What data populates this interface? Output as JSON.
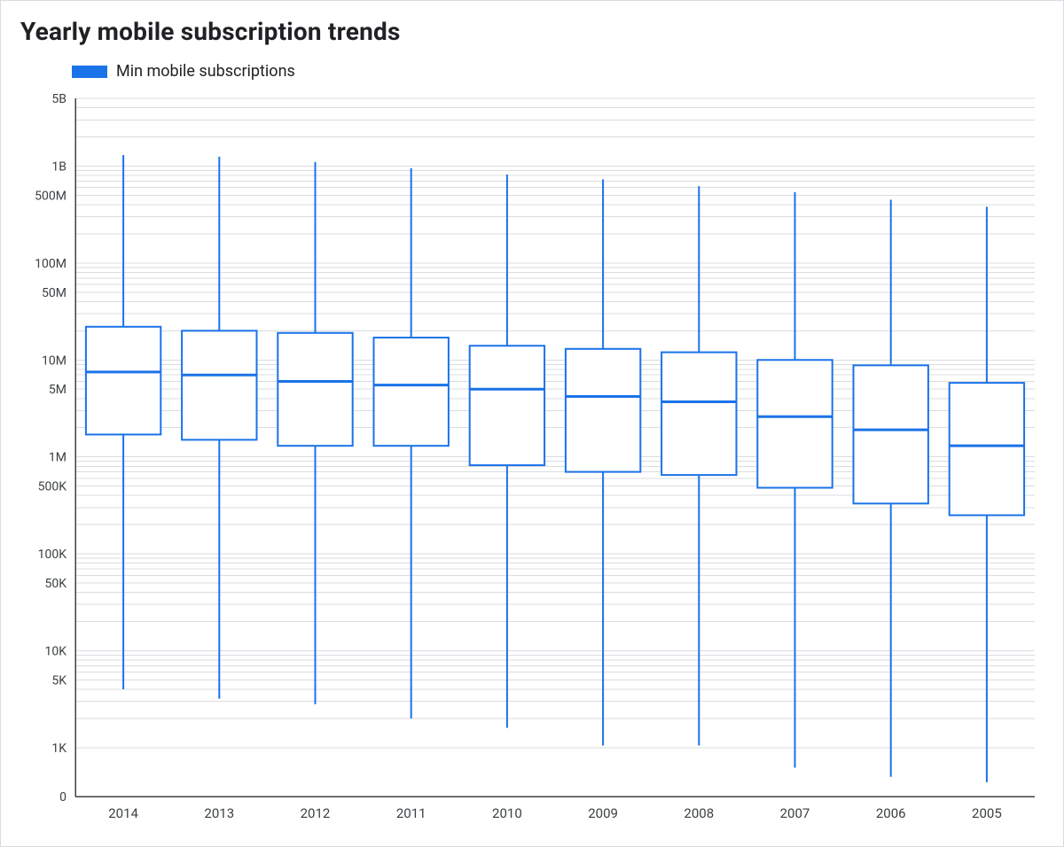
{
  "title": "Yearly mobile subscription trends",
  "legend": {
    "label": "Min mobile subscriptions",
    "color": "#1a73e8"
  },
  "chart_data": {
    "type": "box",
    "xlabel": "",
    "ylabel": "",
    "x_categories": [
      "2014",
      "2013",
      "2012",
      "2011",
      "2010",
      "2009",
      "2008",
      "2007",
      "2006",
      "2005"
    ],
    "y_scale": "log_with_zero",
    "y_ticks": [
      {
        "v": 0,
        "label": "0"
      },
      {
        "v": 1000,
        "label": "1K"
      },
      {
        "v": 5000,
        "label": "5K"
      },
      {
        "v": 10000,
        "label": "10K"
      },
      {
        "v": 50000,
        "label": "50K"
      },
      {
        "v": 100000,
        "label": "100K"
      },
      {
        "v": 500000,
        "label": "500K"
      },
      {
        "v": 1000000,
        "label": "1M"
      },
      {
        "v": 5000000,
        "label": "5M"
      },
      {
        "v": 10000000,
        "label": "10M"
      },
      {
        "v": 50000000,
        "label": "50M"
      },
      {
        "v": 100000000,
        "label": "100M"
      },
      {
        "v": 500000000,
        "label": "500M"
      },
      {
        "v": 1000000000,
        "label": "1B"
      },
      {
        "v": 5000000000,
        "label": "5B"
      }
    ],
    "y_minor_multipliers": [
      2,
      3,
      4,
      5,
      6,
      7,
      8,
      9
    ],
    "series": [
      {
        "name": "Min mobile subscriptions",
        "color": "#1a73e8",
        "boxes": [
          {
            "x": "2014",
            "min": 4000,
            "q1": 1700000,
            "median": 7500000,
            "q3": 22000000,
            "max": 1300000000
          },
          {
            "x": "2013",
            "min": 3200,
            "q1": 1500000,
            "median": 7000000,
            "q3": 20000000,
            "max": 1250000000
          },
          {
            "x": "2012",
            "min": 2800,
            "q1": 1300000,
            "median": 6000000,
            "q3": 19000000,
            "max": 1100000000
          },
          {
            "x": "2011",
            "min": 2000,
            "q1": 1300000,
            "median": 5500000,
            "q3": 17000000,
            "max": 950000000
          },
          {
            "x": "2010",
            "min": 1600,
            "q1": 820000,
            "median": 5000000,
            "q3": 14000000,
            "max": 820000000
          },
          {
            "x": "2009",
            "min": 1050,
            "q1": 700000,
            "median": 4200000,
            "q3": 13000000,
            "max": 730000000
          },
          {
            "x": "2008",
            "min": 1050,
            "q1": 650000,
            "median": 3700000,
            "q3": 12000000,
            "max": 620000000
          },
          {
            "x": "2007",
            "min": 620,
            "q1": 480000,
            "median": 2600000,
            "q3": 10000000,
            "max": 540000000
          },
          {
            "x": "2006",
            "min": 500,
            "q1": 330000,
            "median": 1900000,
            "q3": 8800000,
            "max": 450000000
          },
          {
            "x": "2005",
            "min": 440,
            "q1": 250000,
            "median": 1300000,
            "q3": 5800000,
            "max": 380000000
          }
        ]
      }
    ]
  }
}
